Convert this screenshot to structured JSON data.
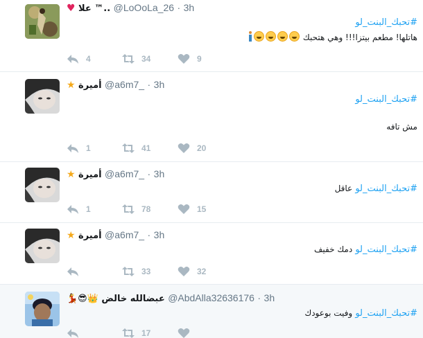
{
  "tweets": [
    {
      "name": "علا ™..",
      "name_prefix": "♥",
      "handle": "@LoOoLa_26",
      "separator": "·",
      "time": "3h",
      "hashtag": "#تحبك_البنت_لو",
      "text": "هاتلها! مطعم بيتزا!!! وهي هتحبك",
      "emojis": 4,
      "reply_count": "4",
      "retweet_count": "34",
      "like_count": "9"
    },
    {
      "name": "أميرة",
      "name_prefix": "★",
      "handle": "@a6m7_",
      "separator": "·",
      "time": "3h",
      "hashtag": "#تحبك_البنت_لو",
      "text": "مش تافه",
      "reply_count": "1",
      "retweet_count": "41",
      "like_count": "20"
    },
    {
      "name": "أميرة",
      "name_prefix": "★",
      "handle": "@a6m7_",
      "separator": "·",
      "time": "3h",
      "hashtag": "#تحبك_البنت_لو",
      "text": "عاقل",
      "reply_count": "1",
      "retweet_count": "78",
      "like_count": "15"
    },
    {
      "name": "أميرة",
      "name_prefix": "★",
      "handle": "@a6m7_",
      "separator": "·",
      "time": "3h",
      "hashtag": "#تحبك_البنت_لو",
      "text": "دمك خفيف",
      "reply_count": "",
      "retweet_count": "33",
      "like_count": "32"
    },
    {
      "name": "عبضالله خالض",
      "name_suffix": "💃😎👑",
      "handle": "@AbdAlla32636176",
      "separator": "·",
      "time": "3h",
      "hashtag": "#تحبك_البنت_لو",
      "text": "وفيت بوعودك",
      "reply_count": "",
      "retweet_count": "17",
      "like_count": ""
    }
  ],
  "colors": {
    "link": "#1da1f2",
    "muted": "#657786",
    "action": "#aab8c2",
    "border": "#e6ecf0",
    "highlight": "#f5f8fa"
  }
}
